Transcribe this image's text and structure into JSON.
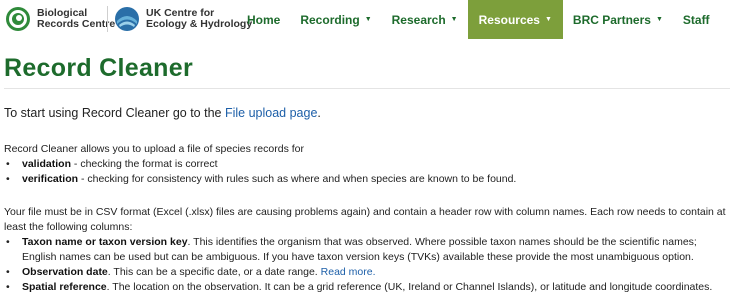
{
  "header": {
    "brc_logo_line1": "Biological",
    "brc_logo_line2": "Records Centre",
    "ukceh_logo_line1": "UK Centre for",
    "ukceh_logo_line2": "Ecology & Hydrology",
    "nav": [
      {
        "label": "Home",
        "dropdown": false,
        "active": false
      },
      {
        "label": "Recording",
        "dropdown": true,
        "active": false
      },
      {
        "label": "Research",
        "dropdown": true,
        "active": false
      },
      {
        "label": "Resources",
        "dropdown": true,
        "active": true
      },
      {
        "label": "BRC Partners",
        "dropdown": true,
        "active": false
      },
      {
        "label": "Staff",
        "dropdown": false,
        "active": false
      }
    ],
    "colors": {
      "brand_green": "#1d6b2c",
      "active_nav": "#7d9f3b"
    }
  },
  "page": {
    "title": "Record Cleaner",
    "lead_prefix": "To start using Record Cleaner go to the ",
    "lead_link": "File upload page",
    "lead_suffix": ".",
    "intro": "Record Cleaner allows you to upload a file of species records for",
    "uses": [
      {
        "term": "validation",
        "text": " - checking the format is correct"
      },
      {
        "term": "verification",
        "text": " - checking for consistency with rules such as where and when species are known to be found."
      }
    ],
    "format_intro": "Your file must be in CSV format (Excel (.xlsx) files are causing problems again) and contain a header row with column names. Each row needs to contain at least the following columns:",
    "columns": [
      {
        "term": "Taxon name or taxon version key",
        "text": ". This identifies the organism that was observed. Where possible taxon names should be the scientific names; English names can be used but can be ambiguous. If you have taxon version keys (TVKs) available these provide the most unambiguous option.",
        "link": ""
      },
      {
        "term": "Observation date",
        "text": ". This can be a specific date, or a date range. ",
        "link": "Read more."
      },
      {
        "term": "Spatial reference",
        "text": ". The location on the observation. It can be a grid reference (UK, Ireland or Channel Islands), or latitude and longitude coordinates.",
        "link": ""
      }
    ]
  }
}
